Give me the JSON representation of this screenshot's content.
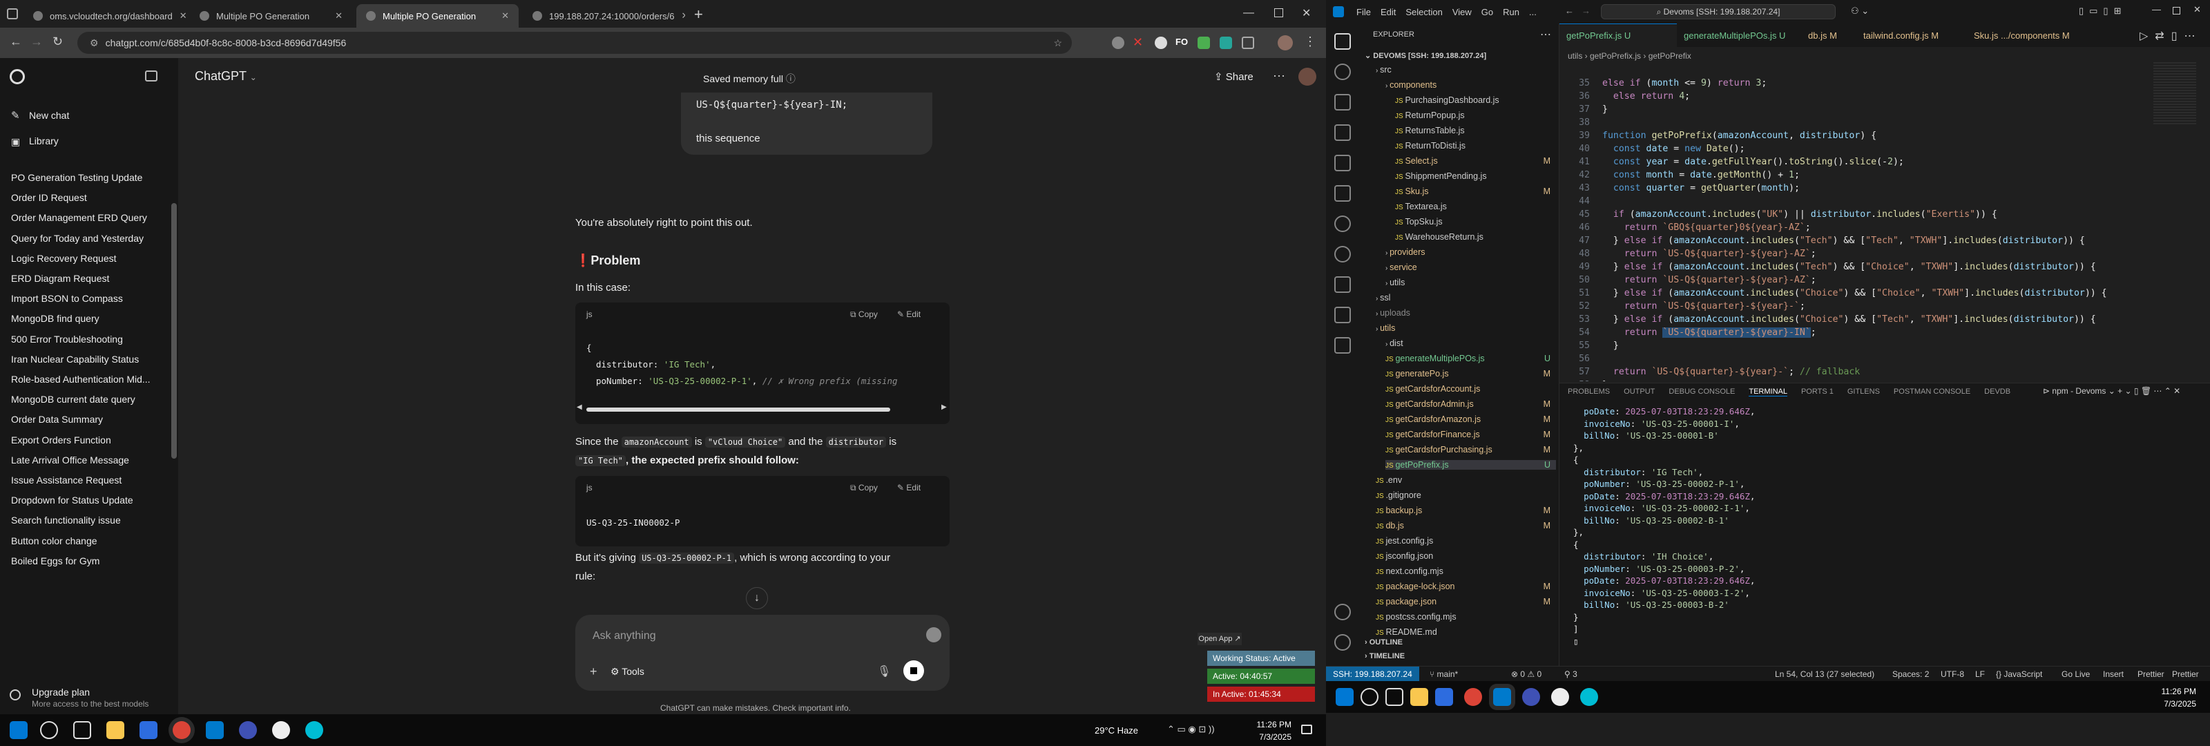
{
  "browser": {
    "tabs": [
      {
        "label": "oms.vcloudtech.org/dashboard",
        "active": false
      },
      {
        "label": "Multiple PO Generation",
        "active": false
      },
      {
        "label": "Multiple PO Generation",
        "active": true
      },
      {
        "label": "199.188.207.24:10000/orders/6",
        "active": false
      }
    ],
    "url": "chatgpt.com/c/685d4b0f-8c8c-8008-b3cd-8696d7d49f56"
  },
  "sidebar": {
    "new_chat": "New chat",
    "library": "Library",
    "chats": [
      "PO Generation Testing Update",
      "Order ID Request",
      "Order Management ERD Query",
      "Query for Today and Yesterday",
      "Logic Recovery Request",
      "ERD Diagram Request",
      "Import BSON to Compass",
      "MongoDB find query",
      "500 Error Troubleshooting",
      "Iran Nuclear Capability Status",
      "Role-based Authentication Mid...",
      "MongoDB current date query",
      "Order Data Summary",
      "Export Orders Function",
      "Late Arrival Office Message",
      "Issue Assistance Request",
      "Dropdown for Status Update",
      "Search functionality issue",
      "Button color change",
      "Boiled Eggs for Gym"
    ],
    "upgrade_title": "Upgrade plan",
    "upgrade_sub": "More access to the best models"
  },
  "chat": {
    "model": "ChatGPT",
    "memory": "Saved memory full",
    "share": "Share",
    "prev_code_line": "US-Q${quarter}-${year}-IN;",
    "prev_text": "this sequence",
    "user_msg": "You're absolutely right to point this out.",
    "problem": "Problem",
    "in_this_case": "In this case:",
    "code1_lang": "js",
    "copy": "Copy",
    "edit": "Edit",
    "code1_line1": "{",
    "code1_line2_key": "distributor",
    "code1_line2_val": "'IG Tech'",
    "code1_line3_key": "poNumber",
    "code1_line3_val": "'US-Q3-25-00002-P-1'",
    "code1_line3_comment": "// ✗ Wrong prefix (missing",
    "since_1": "Since the",
    "since_chip1": "amazonAccount",
    "since_2": "is",
    "since_chip2": "\"vCloud Choice\"",
    "since_3": "and the",
    "since_chip3": "distributor",
    "since_4": "is",
    "since_chip4": "\"IG Tech\"",
    "since_5": ", the expected prefix should follow:",
    "code2_lang": "js",
    "code2_line": "US-Q3-25-IN00002-P",
    "but_1": "But it's giving",
    "but_chip": "US-Q3-25-00002-P-1",
    "but_2": ", which is wrong according to your",
    "but_3": "rule:",
    "input_placeholder": "Ask anything",
    "tools": "Tools",
    "disclaimer": "ChatGPT can make mistakes. Check important info."
  },
  "widget": {
    "open_app": "Open App",
    "status": "Working Status: Active",
    "active": "Active: 04:40:57",
    "inactive": "In Active: 01:45:34"
  },
  "win_tray": {
    "weather": "29°C  Haze",
    "time": "11:26 PM",
    "date": "7/3/2025"
  },
  "vscode": {
    "menu": [
      "File",
      "Edit",
      "Selection",
      "View",
      "Go",
      "Run",
      "..."
    ],
    "search": "Devoms [SSH: 199.188.207.24]",
    "explorer_title": "EXPLORER",
    "root": "DEVOMS [SSH: 199.188.207.24]",
    "tree": [
      {
        "name": "src",
        "kind": "folder",
        "indent": 1,
        "color": "#cccccc",
        "badge": ""
      },
      {
        "name": "components",
        "kind": "folder",
        "indent": 2,
        "color": "#e2c08d",
        "badge": ""
      },
      {
        "name": "PurchasingDashboard.js",
        "kind": "file",
        "indent": 3,
        "color": "#cccccc",
        "badge": ""
      },
      {
        "name": "ReturnPopup.js",
        "kind": "file",
        "indent": 3,
        "color": "#cccccc",
        "badge": ""
      },
      {
        "name": "ReturnsTable.js",
        "kind": "file",
        "indent": 3,
        "color": "#cccccc",
        "badge": ""
      },
      {
        "name": "ReturnToDisti.js",
        "kind": "file",
        "indent": 3,
        "color": "#cccccc",
        "badge": ""
      },
      {
        "name": "Select.js",
        "kind": "file",
        "indent": 3,
        "color": "#e2c08d",
        "badge": "M"
      },
      {
        "name": "ShippmentPending.js",
        "kind": "file",
        "indent": 3,
        "color": "#cccccc",
        "badge": ""
      },
      {
        "name": "Sku.js",
        "kind": "file",
        "indent": 3,
        "color": "#e2c08d",
        "badge": "M"
      },
      {
        "name": "Textarea.js",
        "kind": "file",
        "indent": 3,
        "color": "#cccccc",
        "badge": ""
      },
      {
        "name": "TopSku.js",
        "kind": "file",
        "indent": 3,
        "color": "#cccccc",
        "badge": ""
      },
      {
        "name": "WarehouseReturn.js",
        "kind": "file",
        "indent": 3,
        "color": "#cccccc",
        "badge": ""
      },
      {
        "name": "providers",
        "kind": "folder",
        "indent": 2,
        "color": "#e2c08d",
        "badge": ""
      },
      {
        "name": "service",
        "kind": "folder",
        "indent": 2,
        "color": "#e2c08d",
        "badge": ""
      },
      {
        "name": "utils",
        "kind": "folder",
        "indent": 2,
        "color": "#cccccc",
        "badge": ""
      },
      {
        "name": "ssl",
        "kind": "folder",
        "indent": 1,
        "color": "#cccccc",
        "badge": ""
      },
      {
        "name": "uploads",
        "kind": "folder",
        "indent": 1,
        "color": "#8b8b8b",
        "badge": ""
      },
      {
        "name": "utils",
        "kind": "folder",
        "indent": 1,
        "color": "#e2c08d",
        "badge": ""
      },
      {
        "name": "dist",
        "kind": "folder",
        "indent": 2,
        "color": "#cccccc",
        "badge": ""
      },
      {
        "name": "generateMultiplePOs.js",
        "kind": "file",
        "indent": 2,
        "color": "#73c991",
        "badge": "U"
      },
      {
        "name": "generatePo.js",
        "kind": "file",
        "indent": 2,
        "color": "#e2c08d",
        "badge": "M"
      },
      {
        "name": "getCardsforAccount.js",
        "kind": "file",
        "indent": 2,
        "color": "#e2c08d",
        "badge": ""
      },
      {
        "name": "getCardsforAdmin.js",
        "kind": "file",
        "indent": 2,
        "color": "#e2c08d",
        "badge": "M"
      },
      {
        "name": "getCardsforAmazon.js",
        "kind": "file",
        "indent": 2,
        "color": "#e2c08d",
        "badge": "M"
      },
      {
        "name": "getCardsforFinance.js",
        "kind": "file",
        "indent": 2,
        "color": "#e2c08d",
        "badge": "M"
      },
      {
        "name": "getCardsforPurchasing.js",
        "kind": "file",
        "indent": 2,
        "color": "#e2c08d",
        "badge": "M"
      },
      {
        "name": "getPoPrefix.js",
        "kind": "file",
        "indent": 2,
        "color": "#73c991",
        "badge": "U"
      },
      {
        "name": ".env",
        "kind": "file",
        "indent": 1,
        "color": "#cccccc",
        "badge": ""
      },
      {
        "name": ".gitignore",
        "kind": "file",
        "indent": 1,
        "color": "#cccccc",
        "badge": ""
      },
      {
        "name": "backup.js",
        "kind": "file",
        "indent": 1,
        "color": "#e2c08d",
        "badge": "M"
      },
      {
        "name": "db.js",
        "kind": "file",
        "indent": 1,
        "color": "#e2c08d",
        "badge": "M"
      },
      {
        "name": "jest.config.js",
        "kind": "file",
        "indent": 1,
        "color": "#cccccc",
        "badge": ""
      },
      {
        "name": "jsconfig.json",
        "kind": "file",
        "indent": 1,
        "color": "#cccccc",
        "badge": ""
      },
      {
        "name": "next.config.mjs",
        "kind": "file",
        "indent": 1,
        "color": "#cccccc",
        "badge": ""
      },
      {
        "name": "package-lock.json",
        "kind": "file",
        "indent": 1,
        "color": "#e2c08d",
        "badge": "M"
      },
      {
        "name": "package.json",
        "kind": "file",
        "indent": 1,
        "color": "#e2c08d",
        "badge": "M"
      },
      {
        "name": "postcss.config.mjs",
        "kind": "file",
        "indent": 1,
        "color": "#cccccc",
        "badge": ""
      },
      {
        "name": "README.md",
        "kind": "file",
        "indent": 1,
        "color": "#cccccc",
        "badge": ""
      }
    ],
    "outline": "OUTLINE",
    "timeline": "TIMELINE",
    "editor_tabs": [
      {
        "label": "getPoPrefix.js  U",
        "active": true,
        "color": "#73c991"
      },
      {
        "label": "generateMultiplePOs.js  U",
        "active": false,
        "color": "#73c991"
      },
      {
        "label": "db.js  M",
        "active": false,
        "color": "#e2c08d"
      },
      {
        "label": "tailwind.config.js  M",
        "active": false,
        "color": "#e2c08d"
      },
      {
        "label": "Sku.js .../components  M",
        "active": false,
        "color": "#e2c08d"
      }
    ],
    "breadcrumb": "utils  ›  getPoPrefix.js  ›  getPoPrefix",
    "panel_tabs": [
      "PROBLEMS",
      "OUTPUT",
      "DEBUG CONSOLE",
      "TERMINAL",
      "PORTS 1",
      "GITLENS",
      "POSTMAN CONSOLE",
      "DEVDB"
    ],
    "terminal_name": "npm - Devoms",
    "status": {
      "remote": "SSH: 199.188.207.24",
      "branch": "main*",
      "errors": "⊗ 0  ⚠ 0",
      "ports": "⚲ 3",
      "cursor": "Ln 54, Col 13 (27 selected)",
      "spaces": "Spaces: 2",
      "encoding": "UTF-8",
      "eol": "LF",
      "lang": "{} JavaScript",
      "live": "Go Live",
      "insert": "Insert",
      "prettier": "Prettier"
    },
    "time": "11:26 PM",
    "date": "7/3/2025"
  }
}
